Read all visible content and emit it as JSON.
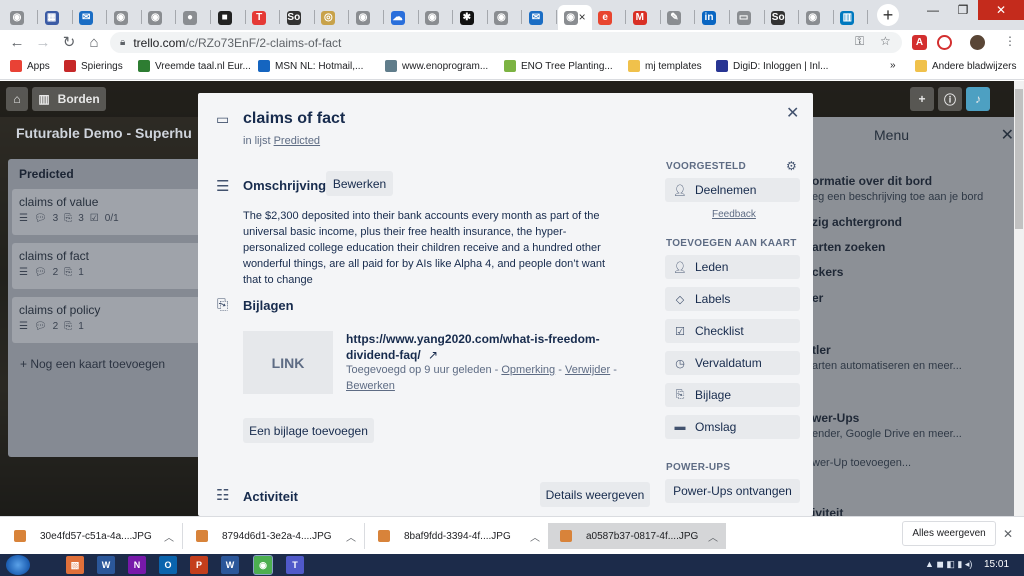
{
  "browser": {
    "tabs": [
      {
        "icon": "chrome-icon",
        "color": "#8a8d91",
        "glyph": "◉"
      },
      {
        "icon": "grid-icon",
        "color": "#3b5ba5",
        "glyph": "▦"
      },
      {
        "icon": "outlook-icon",
        "color": "#1a6dc4",
        "glyph": "✉"
      },
      {
        "icon": "chrome-icon",
        "color": "#8a8d91",
        "glyph": "◉"
      },
      {
        "icon": "chrome-icon",
        "color": "#8a8d91",
        "glyph": "◉"
      },
      {
        "icon": "apple-icon",
        "color": "#8a8d91",
        "glyph": "●"
      },
      {
        "icon": "notion-icon",
        "color": "#222222",
        "glyph": "■"
      },
      {
        "icon": "t-icon",
        "color": "#e53935",
        "glyph": "T"
      },
      {
        "icon": "so-icon",
        "color": "#333333",
        "glyph": "So"
      },
      {
        "icon": "coin-icon",
        "color": "#c8a24a",
        "glyph": "◎"
      },
      {
        "icon": "chrome-icon",
        "color": "#8a8d91",
        "glyph": "◉"
      },
      {
        "icon": "cloud-icon",
        "color": "#2a6fdb",
        "glyph": "☁"
      },
      {
        "icon": "chrome-icon",
        "color": "#8a8d91",
        "glyph": "◉"
      },
      {
        "icon": "star-icon",
        "color": "#111111",
        "glyph": "✱"
      },
      {
        "icon": "chrome-icon",
        "color": "#8a8d91",
        "glyph": "◉"
      },
      {
        "icon": "outlook-icon",
        "color": "#1a6dc4",
        "glyph": "✉"
      },
      {
        "icon": "chrome-icon",
        "color": "#8a8d91",
        "glyph": "◉"
      },
      {
        "icon": "e-icon",
        "color": "#e8452f",
        "glyph": "e"
      },
      {
        "icon": "gmail-icon",
        "color": "#d93025",
        "glyph": "M"
      },
      {
        "icon": "feather-icon",
        "color": "#8a8d91",
        "glyph": "✎"
      },
      {
        "icon": "linkedin-icon",
        "color": "#0a66c2",
        "glyph": "in"
      },
      {
        "icon": "doc-icon",
        "color": "#8a8d91",
        "glyph": "▭"
      },
      {
        "icon": "so-icon",
        "color": "#333333",
        "glyph": "So"
      },
      {
        "icon": "chrome-icon",
        "color": "#8a8d91",
        "glyph": "◉"
      },
      {
        "icon": "trello-icon",
        "color": "#0079bf",
        "glyph": "▥"
      }
    ],
    "active_tab_close": "×",
    "new_tab": "+",
    "url_domain": "trello.com",
    "url_path": "/c/RZo73EnF/2-claims-of-fact",
    "bookmarks": [
      {
        "label": "Apps",
        "color": "#e94235"
      },
      {
        "label": "Spierings",
        "color": "#c62828"
      },
      {
        "label": "Vreemde taal.nl Eur...",
        "color": "#2e7d32"
      },
      {
        "label": "MSN NL: Hotmail,...",
        "color": "#1565c0"
      },
      {
        "label": "www.enoprogram...",
        "color": "#607d8b"
      },
      {
        "label": "ENO Tree Planting...",
        "color": "#7cb342"
      },
      {
        "label": "mj templates",
        "color": "#f0c14b"
      },
      {
        "label": "DigiD: Inloggen | Inl...",
        "color": "#283593"
      }
    ],
    "bookmarks_more": "»",
    "other_bookmarks": "Andere bladwijzers"
  },
  "board": {
    "header_boards": "Borden",
    "title": "Futurable Demo - Superhu",
    "list": {
      "title": "Predicted",
      "cards": [
        {
          "title": "claims of value",
          "comments": "3",
          "attachments": "3",
          "checklist": "0/1"
        },
        {
          "title": "claims of fact",
          "comments": "2",
          "attachments": "1"
        },
        {
          "title": "claims of policy",
          "comments": "2",
          "attachments": "1"
        }
      ],
      "add_card": "+ Nog een kaart toevoegen"
    },
    "menu": {
      "title": "Menu",
      "items": [
        {
          "label": "ormatie over dit bord",
          "sub": "eg een beschrijving toe aan je bord"
        },
        {
          "label": "zig achtergrond"
        },
        {
          "label": "arten zoeken"
        },
        {
          "label": "ckers"
        },
        {
          "label": "er"
        },
        {
          "label": "tler",
          "sub": "arten automatiseren en meer..."
        },
        {
          "label": "wer-Ups",
          "sub": "ender, Google Drive en meer...",
          "sub2": "wer-Up toevoegen..."
        },
        {
          "label": "iviteit"
        }
      ]
    }
  },
  "card": {
    "title": "claims of fact",
    "in_list_prefix": "in lijst",
    "list_name": "Predicted",
    "description_heading": "Omschrijving",
    "edit_button": "Bewerken",
    "description": "The $2,300 deposited into their bank accounts every month as part of the universal basic income, plus their free health insurance, the hyper-personalized college education their children receive and a hundred other wonderful things, are all paid for by AIs like Alpha 4, and people don’t want that to change",
    "attachments_heading": "Bijlagen",
    "attachment": {
      "thumb_label": "LINK",
      "name": "https://www.yang2020.com/what-is-freedom-dividend-faq/",
      "name_arrow": "↗",
      "added": "Toegevoegd op 9 uur geleden",
      "comment_link": "Opmerking",
      "delete_link": "Verwijder",
      "edit_link": "Bewerken",
      "separator": "-"
    },
    "add_attachment": "Een bijlage toevoegen",
    "activity_heading": "Activiteit",
    "details_button": "Details weergeven",
    "sidebar": {
      "suggested_heading": "VOORGESTELD",
      "join": "Deelnemen",
      "feedback": "Feedback",
      "add_heading": "TOEVOEGEN AAN KAART",
      "members": "Leden",
      "labels": "Labels",
      "checklist": "Checklist",
      "due_date": "Vervaldatum",
      "attachment": "Bijlage",
      "cover": "Omslag",
      "powerups_heading": "POWER-UPS",
      "get_powerups": "Power-Ups ontvangen"
    }
  },
  "downloads": {
    "items": [
      {
        "name": "30e4fd57-c51a-4a....JPG"
      },
      {
        "name": "8794d6d1-3e2a-4....JPG"
      },
      {
        "name": "8baf9fdd-3394-4f....JPG"
      },
      {
        "name": "a0587b37-0817-4f....JPG"
      }
    ],
    "show_all": "Alles weergeven"
  },
  "taskbar": {
    "apps": [
      {
        "icon": "paint-icon",
        "color": "#e0703a",
        "glyph": "▧"
      },
      {
        "icon": "word-icon",
        "color": "#2b579a",
        "glyph": "W"
      },
      {
        "icon": "onenote-icon",
        "color": "#7719aa",
        "glyph": "N"
      },
      {
        "icon": "outlook-icon",
        "color": "#0a64ad",
        "glyph": "O"
      },
      {
        "icon": "powerpoint-icon",
        "color": "#c43e1c",
        "glyph": "P"
      },
      {
        "icon": "word-icon",
        "color": "#2b579a",
        "glyph": "W"
      },
      {
        "icon": "chrome-icon",
        "color": "#4caf50",
        "glyph": "◉"
      },
      {
        "icon": "teams-icon",
        "color": "#5059c9",
        "glyph": "T"
      }
    ],
    "time": "15:01"
  }
}
